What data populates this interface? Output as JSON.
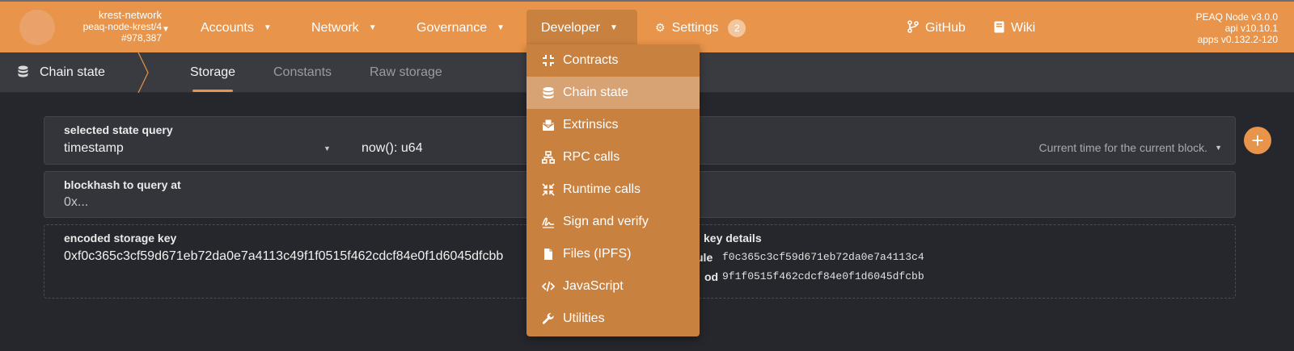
{
  "chain": {
    "name": "krest-network",
    "node": "peaq-node-krest/4",
    "block": "#978,387"
  },
  "nav": {
    "accounts": "Accounts",
    "network": "Network",
    "governance": "Governance",
    "developer": "Developer",
    "settings": "Settings",
    "settings_badge": "2",
    "github": "GitHub",
    "wiki": "Wiki"
  },
  "versions": {
    "node": "PEAQ Node v3.0.0",
    "api": "api v10.10.1",
    "apps": "apps v0.132.2-120"
  },
  "subnav": {
    "section": "Chain state",
    "tabs": [
      "Storage",
      "Constants",
      "Raw storage"
    ],
    "active_tab": "Storage"
  },
  "query": {
    "label": "selected state query",
    "value": "timestamp",
    "signature": "now(): u64",
    "description": "Current time for the current block."
  },
  "blockhash": {
    "label": "blockhash to query at",
    "placeholder": "0x..."
  },
  "encoded_key": {
    "label": "encoded storage key",
    "value": "0xf0c365c3cf59d671eb72da0e7a4113c49f1f0515f462cdcf84e0f1d6045dfcbb"
  },
  "key_details": {
    "label": "key details",
    "module_label": "ule",
    "module_value": "f0c365c3cf59d671eb72da0e7a4113c4",
    "method_label": "od",
    "method_value": "9f1f0515f462cdcf84e0f1d6045dfcbb"
  },
  "developer_menu": {
    "items": [
      {
        "label": "Contracts",
        "icon": "contracts-icon"
      },
      {
        "label": "Chain state",
        "icon": "database-icon"
      },
      {
        "label": "Extrinsics",
        "icon": "envelope-icon"
      },
      {
        "label": "RPC calls",
        "icon": "network-icon"
      },
      {
        "label": "Runtime calls",
        "icon": "arrows-icon"
      },
      {
        "label": "Sign and verify",
        "icon": "signature-icon"
      },
      {
        "label": "Files (IPFS)",
        "icon": "file-icon"
      },
      {
        "label": "JavaScript",
        "icon": "code-icon"
      },
      {
        "label": "Utilities",
        "icon": "wrench-icon"
      }
    ],
    "active": "Chain state"
  },
  "colors": {
    "accent": "#e8944a",
    "background": "#26272c",
    "menu": "#c9813f",
    "menu_active": "#d7a274"
  }
}
